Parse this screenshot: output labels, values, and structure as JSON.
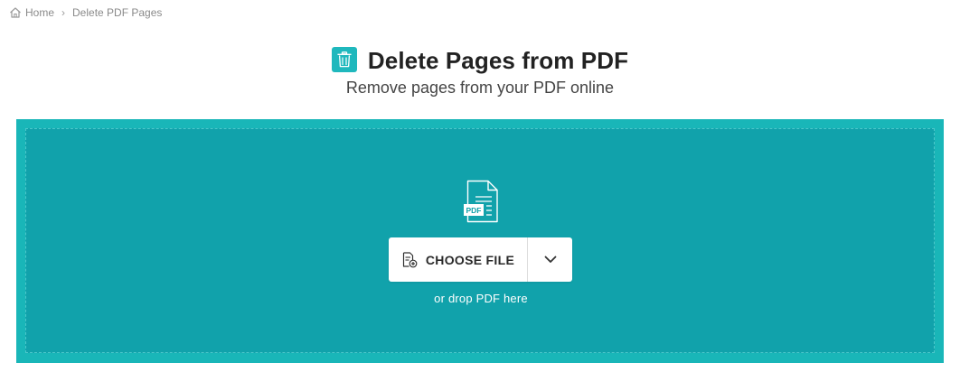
{
  "breadcrumb": {
    "home_label": "Home",
    "separator": "›",
    "current_label": "Delete PDF Pages"
  },
  "header": {
    "title": "Delete Pages from PDF",
    "subtitle": "Remove pages from your PDF online",
    "icon": "trash-icon",
    "accent_color": "#1fb8bd"
  },
  "upload": {
    "file_icon": "pdf-file-icon",
    "file_icon_badge": "PDF",
    "choose_file_label": "CHOOSE FILE",
    "choose_file_icon": "add-file-icon",
    "dropdown_icon": "chevron-down-icon",
    "drop_hint": "or drop PDF here",
    "outer_color": "#19b6b8",
    "inner_color": "#11a2ab"
  }
}
